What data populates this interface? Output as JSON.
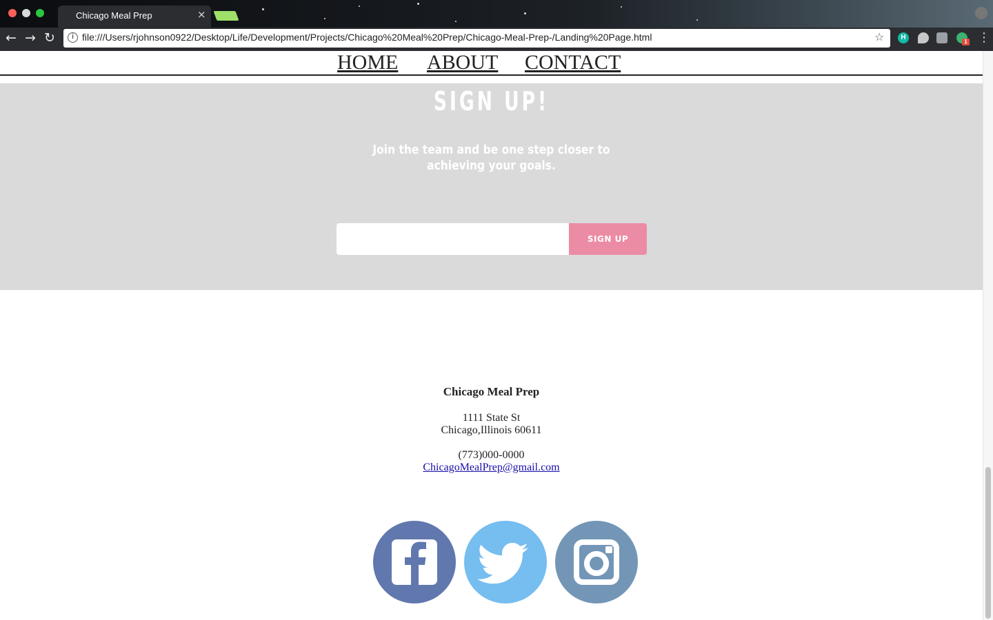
{
  "browser": {
    "tab_title": "Chicago Meal Prep",
    "tab_close": "×",
    "url": "file:///Users/rjohnson0922/Desktop/Life/Development/Projects/Chicago%20Meal%20Prep/Chicago-Meal-Prep-/Landing%20Page.html",
    "back_icon": "←",
    "forward_icon": "→",
    "reload_icon": "↻",
    "star_icon": "☆",
    "menu_icon": "⋮",
    "info_icon": "i",
    "extensions": [
      {
        "name": "h-extension",
        "label": "H"
      },
      {
        "name": "pin-extension",
        "label": ""
      },
      {
        "name": "wrench-extension",
        "label": ""
      },
      {
        "name": "green-extension",
        "label": "",
        "badge": "1"
      }
    ]
  },
  "nav": {
    "items": [
      "HOME",
      "ABOUT",
      "CONTACT"
    ]
  },
  "signup": {
    "title": "SIGN UP!",
    "subtitle": "Join the team and be one step closer to achieving your goals.",
    "input_value": "",
    "button_label": "SIGN UP"
  },
  "footer": {
    "company": "Chicago Meal Prep",
    "address_line1": "1111 State St",
    "address_line2": "Chicago,Illinois 60611",
    "phone": "(773)000-0000",
    "email": "ChicagoMealPrep@gmail.com"
  },
  "social": {
    "icons": [
      "facebook-icon",
      "twitter-icon",
      "instagram-icon"
    ]
  },
  "colors": {
    "signup_bg": "#dadada",
    "signup_button": "#ec8ba4",
    "facebook": "#6078ae",
    "twitter": "#76bdf0",
    "instagram": "#7396b7"
  }
}
